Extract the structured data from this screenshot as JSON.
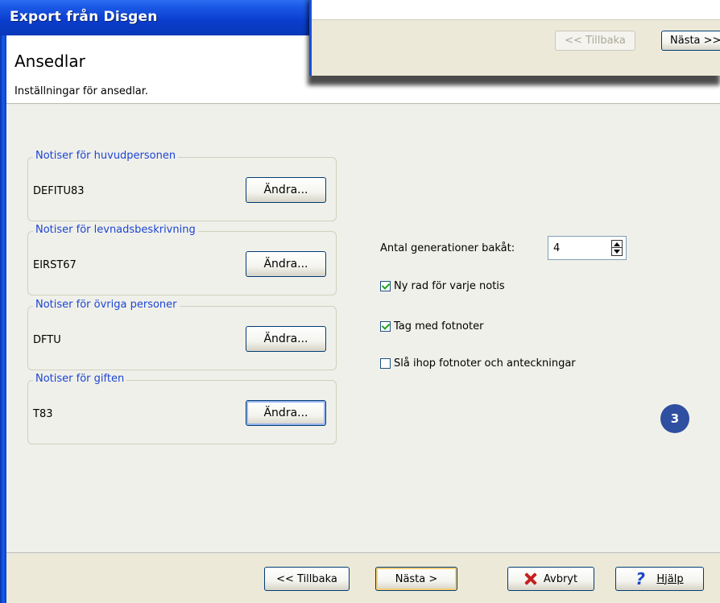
{
  "window": {
    "title": "Export från Disgen"
  },
  "header": {
    "title": "Ansedlar",
    "subtitle": "Inställningar för ansedlar."
  },
  "overlay": {
    "back_label": "<< Tillbaka",
    "next_label": "Nästa >>"
  },
  "groups": [
    {
      "title": "Notiser för huvudpersonen",
      "value": "DEFITU83",
      "button": "Ändra..."
    },
    {
      "title": "Notiser för levnadsbeskrivning",
      "value": "EIRST67",
      "button": "Ändra..."
    },
    {
      "title": "Notiser för övriga personer",
      "value": "DFTU",
      "button": "Ändra..."
    },
    {
      "title": "Notiser för giften",
      "value": "T83",
      "button": "Ändra..."
    }
  ],
  "generations": {
    "label": "Antal generationer bakåt:",
    "value": "4"
  },
  "options": [
    {
      "label": "Ny rad för varje notis",
      "checked": true
    },
    {
      "label": "Tag med fotnoter",
      "checked": true
    },
    {
      "label": "Slå ihop fotnoter och anteckningar",
      "checked": false
    }
  ],
  "badge": "3",
  "footer": {
    "back_label": "<< Tillbaka",
    "next_label": "Nästa >",
    "cancel_label": "Avbryt",
    "help_label": "Hjälp"
  },
  "colors": {
    "title_bar": "#0a3ccc",
    "group_title": "#1c45d4",
    "badge": "#2f4fa0"
  }
}
